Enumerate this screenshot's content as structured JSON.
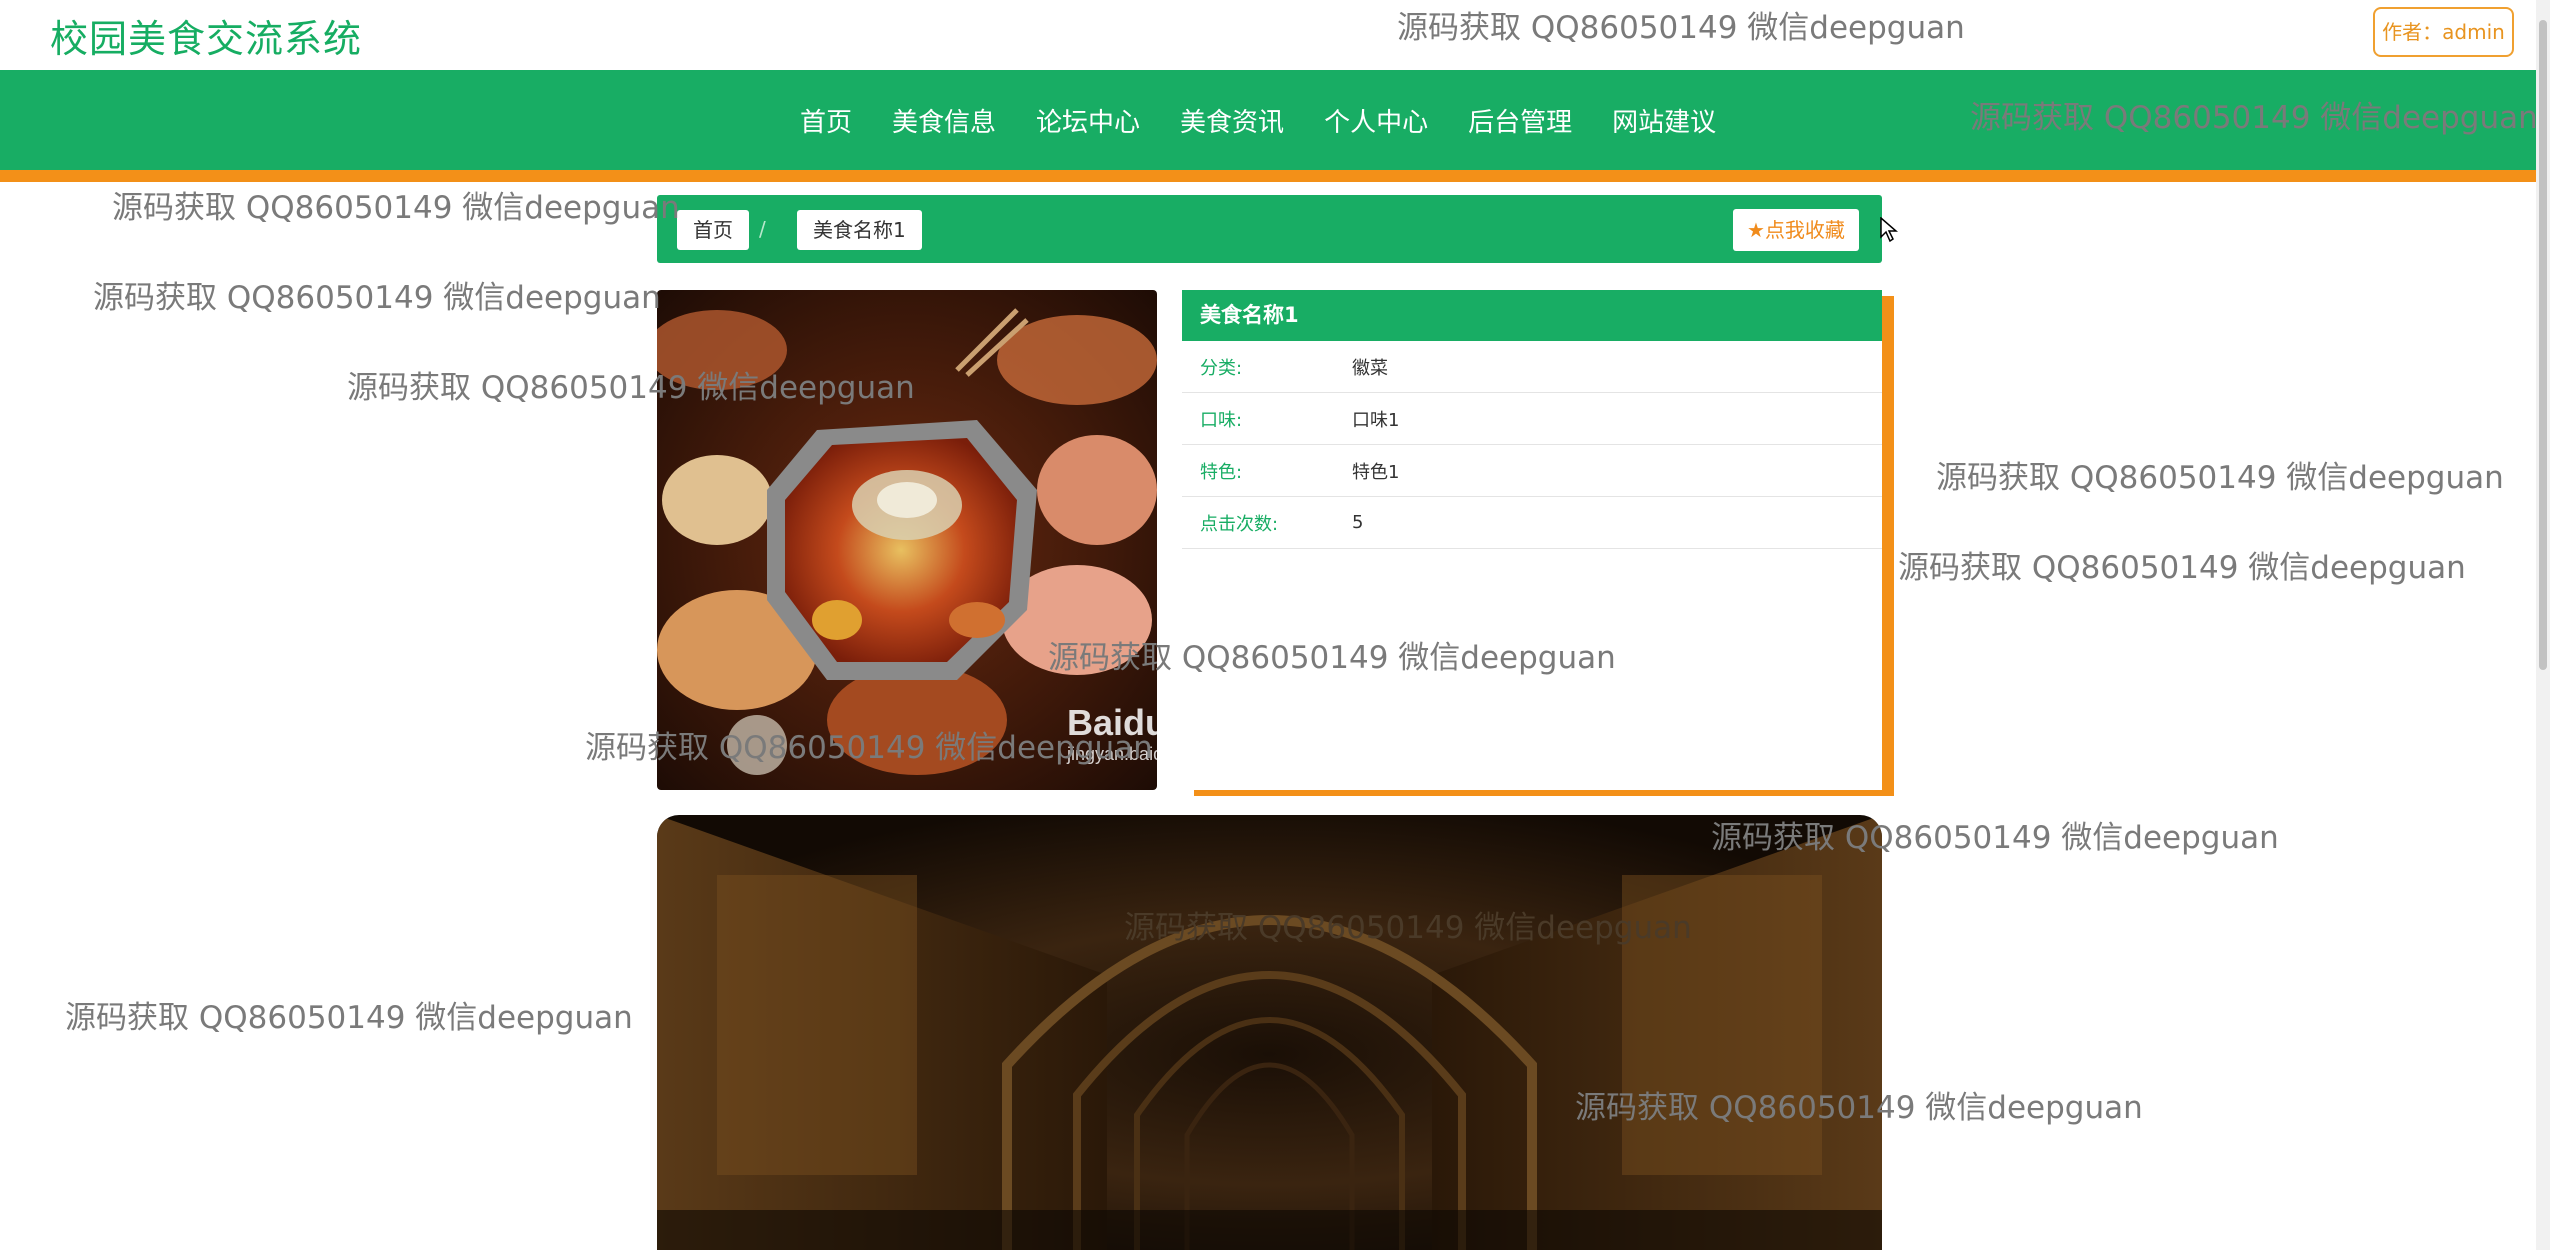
{
  "header": {
    "site_title": "校园美食交流系统",
    "author_label": "作者：admin"
  },
  "nav": {
    "items": [
      "首页",
      "美食信息",
      "论坛中心",
      "美食资讯",
      "个人中心",
      "后台管理",
      "网站建议"
    ]
  },
  "breadcrumb": {
    "home": "首页",
    "separator": "/",
    "current": "美食名称1",
    "favorite_label": "点我收藏"
  },
  "food": {
    "name": "美食名称1",
    "fields": [
      {
        "label": "分类:",
        "value": "徽菜"
      },
      {
        "label": "口味:",
        "value": "口味1"
      },
      {
        "label": "特色:",
        "value": "特色1"
      },
      {
        "label": "点击次数:",
        "value": "5"
      }
    ],
    "image_watermark": "Baidu",
    "image_watermark_sub": "jingyan.baidu"
  },
  "watermark_text": "源码获取 QQ86050149 微信deepguan",
  "colors": {
    "primary": "#18ad64",
    "accent": "#f39018"
  }
}
